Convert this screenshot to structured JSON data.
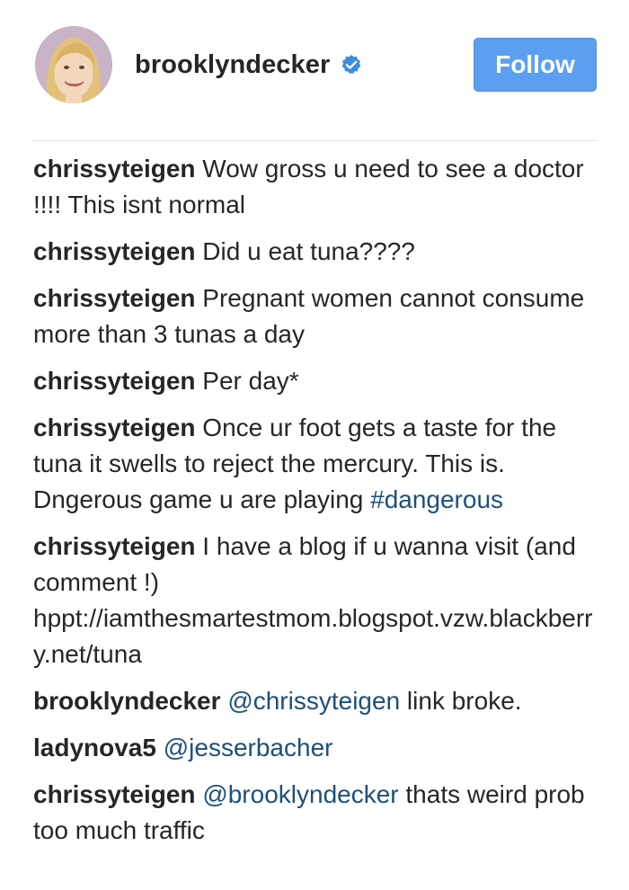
{
  "post_header": {
    "username": "brooklyndecker",
    "verified_icon": "verified-badge-icon",
    "follow_label": "Follow"
  },
  "colors": {
    "follow_button": "#5b9ff0",
    "link": "#1d4f7c",
    "verified": "#3b8de0"
  },
  "comments": [
    {
      "user": "chrissyteigen",
      "parts": [
        {
          "type": "text",
          "text": " Wow gross u need to see a doctor !!!! This isnt normal"
        }
      ]
    },
    {
      "user": "chrissyteigen",
      "parts": [
        {
          "type": "text",
          "text": " Did u eat tuna????"
        }
      ]
    },
    {
      "user": "chrissyteigen",
      "parts": [
        {
          "type": "text",
          "text": " Pregnant women cannot consume more than 3 tunas a day"
        }
      ]
    },
    {
      "user": "chrissyteigen",
      "parts": [
        {
          "type": "text",
          "text": " Per day*"
        }
      ]
    },
    {
      "user": "chrissyteigen",
      "parts": [
        {
          "type": "text",
          "text": " Once ur foot gets a taste for the tuna it swells to reject the mercury. This is. Dngerous game u are playing "
        },
        {
          "type": "link",
          "text": "#dangerous"
        }
      ]
    },
    {
      "user": "chrissyteigen",
      "parts": [
        {
          "type": "text",
          "text": " I have a blog if u wanna visit (and comment !) hppt://iamthesmartestmom.blogspot.vzw.blackberry.net/tuna"
        }
      ]
    },
    {
      "user": "brooklyndecker",
      "parts": [
        {
          "type": "text",
          "text": " "
        },
        {
          "type": "link",
          "text": "@chrissyteigen"
        },
        {
          "type": "text",
          "text": " link broke."
        }
      ]
    },
    {
      "user": "ladynova5",
      "parts": [
        {
          "type": "text",
          "text": " "
        },
        {
          "type": "link",
          "text": "@jesserbacher"
        }
      ]
    },
    {
      "user": "chrissyteigen",
      "parts": [
        {
          "type": "text",
          "text": " "
        },
        {
          "type": "link",
          "text": "@brooklyndecker"
        },
        {
          "type": "text",
          "text": " thats weird prob too much traffic"
        }
      ]
    }
  ]
}
